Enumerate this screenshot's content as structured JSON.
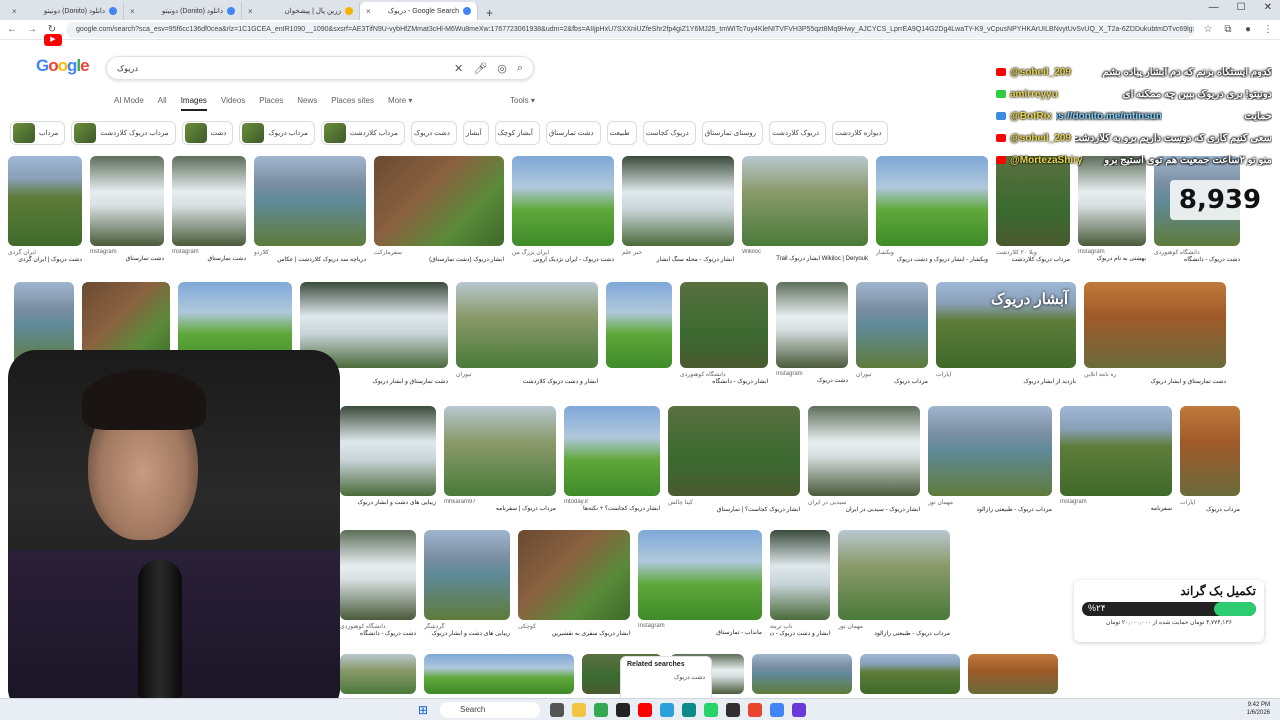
{
  "browser": {
    "tabs": [
      {
        "title": "دانلود (Donito) دونیتو",
        "color": "#4285f4"
      },
      {
        "title": "دانلود (Donito) دونیتو",
        "color": "#4285f4"
      },
      {
        "title": "زرین پال | پیشخوان",
        "color": "#f4b400"
      },
      {
        "title": "Google Search - دریوک",
        "color": "#4285f4",
        "active": true
      }
    ],
    "new_tab": "+",
    "url": "google.com/search?sca_esv=95f6cc136df0cea&rlz=1C1GCEA_enIR1090__1090&sxsrf=AE3TifN9U-vybHfZMmat3cHl-M6Wu8meXw:1767723061938&udm=2&fbs=AIIjpHxU7SXXniUZfeShr2fp4giZ1Y6MJ25_tmWITc7uy4KleNITVFVH3P55qzt8Mq9Hwy_AJCYCS_LprrEA9Q14G2Dg4LwaTY-K9_vCpusNPYHKArUILBNvytUvSvUQ_X_T2a-6ZDDukubtmDTvc69lgSeINS..."
  },
  "google": {
    "logo": [
      "G",
      "o",
      "o",
      "g",
      "l",
      "e"
    ],
    "query": "دریوک",
    "tabs": [
      "AI Mode",
      "All",
      "Images",
      "Videos",
      "Places",
      "News",
      "Places sites",
      "More ▾"
    ],
    "active_tab": "Images",
    "tools": "Tools ▾",
    "chips": [
      "مرداب",
      "مرداب دریوک کلاردشت",
      "دشت",
      "مرداب دریوک",
      "مرداب کلاردشت",
      "دشت دریوک",
      "آبشار",
      "آبشار کوچک",
      "دشت تمارستاق",
      "طبیعت",
      "دریوک کجاست",
      "روستای تمارستاق",
      "دریوک کلاردشت",
      "دیواره کلاردشت"
    ]
  },
  "results": {
    "row1": [
      {
        "src": "ایران گردی",
        "title": "دشت دریوک | ایران گردی"
      },
      {
        "src": "Instagram",
        "title": "دشت تمارستاق"
      },
      {
        "src": "Instagram",
        "title": "دشت تمارستاق"
      },
      {
        "src": "کلاردو",
        "title": "دریاچه سد دریوک کلاردشت | عکاس"
      },
      {
        "src": "سفرمارکت",
        "title": "آبشار دریوک (دشت تمارستاق)"
      },
      {
        "src": "ایران بزرگ من",
        "title": "دشت دریوک - ایران نژدیک ارونی"
      },
      {
        "src": "خبر علم",
        "title": "آبشار دریوک - محله سنگ آبشار"
      },
      {
        "src": "Wikiloc",
        "title": "Wikiloc | Deryouk آبشار دریوک Trail"
      },
      {
        "src": "ویکشار",
        "title": "ویکشار - آبشار دریوک و دشت دریوک"
      },
      {
        "src": "ویلا ۲۰ کلاردشت",
        "title": "مرداب دریوک کلاردشت"
      },
      {
        "src": "Instagram",
        "title": "بهشتی به نام دریوک"
      },
      {
        "src": "دانشگاه کوهنوردی",
        "title": "دشت دریوک - دانشگاه"
      }
    ],
    "row2_overlay": "آبشار دریوک",
    "row2": [
      {
        "src": "",
        "title": ""
      },
      {
        "src": "",
        "title": ""
      },
      {
        "src": "",
        "title": ""
      },
      {
        "src": "ره نامه آنلاین",
        "title": "دشت تمارستاق و آبشار دریوک"
      },
      {
        "src": "تیوران",
        "title": "آبشار و دشت دریوک کلاردشت"
      },
      {
        "src": "",
        "title": ""
      },
      {
        "src": "دانشگاه کوهنوردی",
        "title": "آبشار دریوک - دانشگاه"
      },
      {
        "src": "Instagram",
        "title": "دشت دریوک"
      },
      {
        "src": "تیوران",
        "title": "مرداب دریوک"
      },
      {
        "src": "آپارات",
        "title": "بازدید از آبشار دریوک"
      },
      {
        "src": "ره نامه آنلاین",
        "title": "دشت تمارستاق و آبشار دریوک"
      }
    ],
    "row3": [
      {
        "src": "",
        "title": "زیبایی های دشت و آبشار دریوک"
      },
      {
        "src": "mhkaram97",
        "title": "مرداب دریوک | سفرنامه"
      },
      {
        "src": "Intoday.ir",
        "title": "آبشار دریوک کجاست؟ + نکته‌ها"
      },
      {
        "src": "کیتا چالش",
        "title": "آبشار دریوک کجاست؟ | تمارستاق"
      },
      {
        "src": "سیدبی در ایران",
        "title": "آبشار دریوک - سیدبی در ایران"
      },
      {
        "src": "مهمان تور",
        "title": "مرداب دریوک - طبیعتی رازآلود"
      },
      {
        "src": "Instagram",
        "title": "سفرنامه"
      },
      {
        "src": "آپارات",
        "title": "مرداب دریوک"
      }
    ],
    "row4": [
      {
        "src": "دانشگاه کوهنوردی",
        "title": "دشت دریوک - دانشگاه"
      },
      {
        "src": "گردشگر",
        "title": "زیبایی های دشت و آبشار دریوک"
      },
      {
        "src": "کوچکی",
        "title": "آبشار دریوک سفری به نقشیرین"
      },
      {
        "src": "Instagram",
        "title": "مانداب - تمارستاق"
      },
      {
        "src": "تاپ ترینه",
        "title": "آبشار و دشت دریوک - دیدنی"
      },
      {
        "src": "مهمان تور",
        "title": "مرداب دریوک - طبیعتی رازآلود"
      }
    ],
    "related_heading": "Related searches",
    "related_item": "دشت دریوک"
  },
  "stream": {
    "counter": "8,939",
    "chat": [
      {
        "user": "@soheil_209",
        "msg": "کدوم ایستگاه بزنم که دم آبشار پیاده بشم",
        "badge": "#ff0000"
      },
      {
        "user": "amirreyyu",
        "msg": "دونیتو! بری دریوک ببین چه ممکنه ای",
        "badge": "#2ecc40"
      },
      {
        "user": "@BotRix",
        "msg": "حمایت",
        "link": "https://donito.me/mtinsun",
        "badge": "#3a8dde"
      },
      {
        "user": "@soheil_209",
        "msg": "سعی کنیم کاری که دوست داریم برو به کلاردشت",
        "badge": "#ff0000"
      },
      {
        "user": "@MortezaShiry",
        "msg": "منو تو ۲ساعت جمعیت هم توی استیج برو",
        "badge": "#ff0000"
      }
    ],
    "progress": {
      "title": "تکمیل بک گراند",
      "percent_label": "%۲۴",
      "percent": 24,
      "subtitle": "۴,۷۷۴,۱۳۶ تومان حمایت شده از ۲۰,۰۰۰,۰۰۰ تومان"
    }
  },
  "taskbar": {
    "search_label": "Search",
    "time": "9:42 PM",
    "date": "1/6/2026"
  }
}
